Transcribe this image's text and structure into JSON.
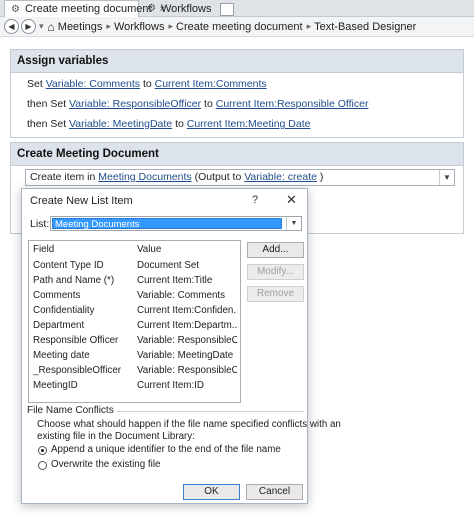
{
  "tabs": [
    {
      "label": "Create meeting document",
      "icon": "workflow-icon",
      "active": true
    },
    {
      "label": "Workflows",
      "icon": "workflow-icon",
      "active": false
    }
  ],
  "breadcrumb": [
    "Meetings",
    "Workflows",
    "Create meeting document",
    "Text-Based Designer"
  ],
  "assign": {
    "title": "Assign variables",
    "lines": [
      {
        "prefix": "Set ",
        "var": "Variable: Comments",
        "to": " to ",
        "value": "Current Item:Comments"
      },
      {
        "prefix": "then Set ",
        "var": "Variable: ResponsibleOfficer",
        "to": " to ",
        "value": "Current Item:Responsible Officer"
      },
      {
        "prefix": "then Set ",
        "var": "Variable: MeetingDate",
        "to": " to ",
        "value": "Current Item:Meeting Date"
      }
    ]
  },
  "create": {
    "title": "Create Meeting Document",
    "action_prefix": "Create item in ",
    "action_list": "Meeting Documents",
    "action_mid": " (Output to ",
    "action_var": "Variable: create",
    "action_suffix": " )"
  },
  "dialog": {
    "title": "Create New List Item",
    "help": "?",
    "list_label": "List:",
    "list_value": "Meeting Documents",
    "columns": [
      "Field",
      "Value"
    ],
    "rows": [
      [
        "Content Type ID",
        "Document Set"
      ],
      [
        "Path and Name (*)",
        "Current Item:Title"
      ],
      [
        "Comments",
        "Variable: Comments"
      ],
      [
        "Confidentiality",
        "Current Item:Confiden..."
      ],
      [
        "Department",
        "Current Item:Departm..."
      ],
      [
        "Responsible Officer",
        "Variable: ResponsibleO..."
      ],
      [
        "Meeting date",
        "Variable: MeetingDate"
      ],
      [
        "_ResponsibleOfficer",
        "Variable: ResponsibleO..."
      ],
      [
        "MeetingID",
        "Current Item:ID"
      ]
    ],
    "buttons": {
      "add": "Add...",
      "modify": "Modify...",
      "remove": "Remove",
      "ok": "OK",
      "cancel": "Cancel"
    },
    "conflicts": {
      "label": "File Name Conflicts",
      "desc1": "Choose what should happen if the file name specified conflicts with an",
      "desc2": "existing file in the Document Library:",
      "opt1": "Append a unique identifier to the end of the file name",
      "opt2": "Overwrite the existing file",
      "selected": 0
    }
  },
  "colors": {
    "link": "#1f4d8c",
    "panel_header": "#dde3ea",
    "selection": "#3399ff"
  }
}
